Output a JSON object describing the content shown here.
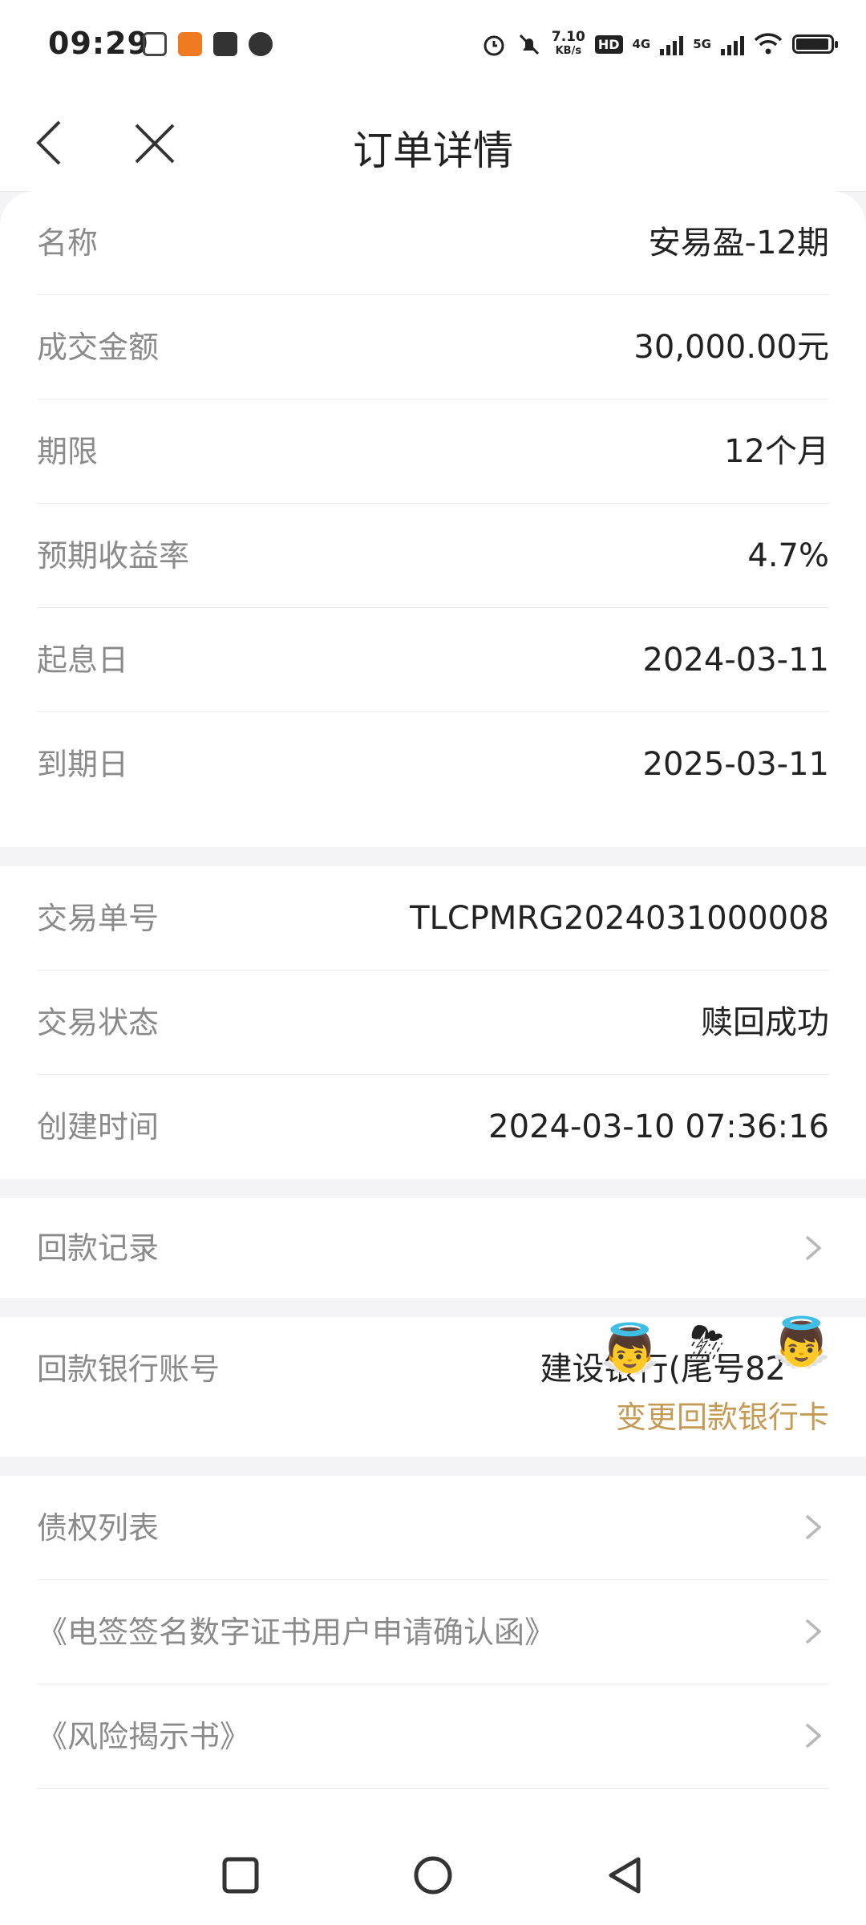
{
  "status_bar": {
    "time": "09:29",
    "net_speed": "7.10",
    "net_speed_unit": "KB/s",
    "network_1": "4G",
    "network_2": "5G"
  },
  "header": {
    "title": "订单详情"
  },
  "product_info": [
    {
      "label": "名称",
      "value": "安易盈-12期"
    },
    {
      "label": "成交金额",
      "value": "30,000.00元"
    },
    {
      "label": "期限",
      "value": "12个月"
    },
    {
      "label": "预期收益率",
      "value": "4.7%"
    },
    {
      "label": "起息日",
      "value": "2024-03-11"
    },
    {
      "label": "到期日",
      "value": "2025-03-11"
    }
  ],
  "trade_info": [
    {
      "label": "交易单号",
      "value": "TLCPMRG2024031000008"
    },
    {
      "label": "交易状态",
      "value": "赎回成功"
    },
    {
      "label": "创建时间",
      "value": "2024-03-10 07:36:16"
    }
  ],
  "repayment_record": {
    "label": "回款记录"
  },
  "repayment_account": {
    "label": "回款银行账号",
    "value": "建设银行(尾号82",
    "change_link": "变更回款银行卡"
  },
  "doc_links": [
    {
      "label": "债权列表"
    },
    {
      "label": "《电签签名数字证书用户申请确认函》"
    },
    {
      "label": "《风险揭示书》"
    }
  ],
  "colors": {
    "accent": "#c59a55",
    "label": "#8a8a8a",
    "background": "#f4f4f6"
  }
}
